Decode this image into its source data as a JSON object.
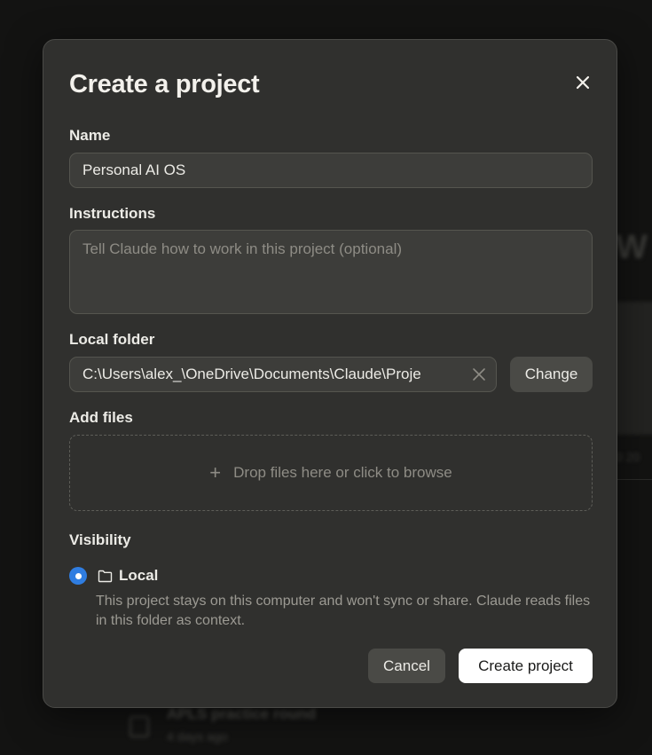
{
  "background": {
    "heading_fragment": "W",
    "meta_fragment": "0 20",
    "recent_item": {
      "title": "APLS practice round",
      "subtitle": "4 days ago"
    }
  },
  "modal": {
    "title": "Create a project",
    "close_icon": "close-icon",
    "name": {
      "label": "Name",
      "value": "Personal AI OS"
    },
    "instructions": {
      "label": "Instructions",
      "value": "",
      "placeholder": "Tell Claude how to work in this project (optional)"
    },
    "local_folder": {
      "label": "Local folder",
      "path": "C:\\Users\\alex_\\OneDrive\\Documents\\Claude\\Proje",
      "clear_icon": "clear-icon",
      "change_label": "Change"
    },
    "add_files": {
      "label": "Add files",
      "plus_symbol": "+",
      "dropzone_text": "Drop files here or click to browse"
    },
    "visibility": {
      "label": "Visibility",
      "options": [
        {
          "label": "Local",
          "icon": "folder-icon",
          "selected": true,
          "description": "This project stays on this computer and won't sync or share. Claude reads files in this folder as context."
        }
      ]
    },
    "actions": {
      "cancel_label": "Cancel",
      "create_label": "Create project"
    }
  },
  "colors": {
    "modal_bg": "#30302e",
    "input_bg": "#3d3d3a",
    "accent": "#2f7de1",
    "primary_button_bg": "#ffffff"
  }
}
